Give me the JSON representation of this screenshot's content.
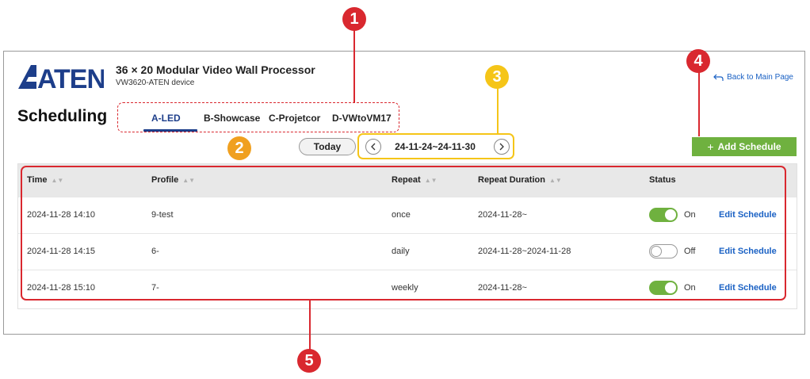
{
  "header": {
    "logo_text": "ATEN",
    "product_title": "36 × 20 Modular Video Wall Processor",
    "device_name": "VW3620-ATEN device",
    "back_link": "Back to Main Page"
  },
  "page_title": "Scheduling",
  "tabs": [
    {
      "label": "A-LED",
      "active": true
    },
    {
      "label": "B-Showcase",
      "active": false
    },
    {
      "label": "C-Projetcor",
      "active": false
    },
    {
      "label": "D-VWtoVM17",
      "active": false
    }
  ],
  "controls": {
    "today_label": "Today",
    "date_range": "24-11-24~24-11-30",
    "add_schedule_label": "Add Schedule"
  },
  "table": {
    "columns": [
      "Time",
      "Profile",
      "Repeat",
      "Repeat Duration",
      "Status"
    ],
    "rows": [
      {
        "time": "2024-11-28 14:10",
        "profile": "9-test",
        "repeat": "once",
        "duration": "2024-11-28~",
        "status": "On",
        "on": true,
        "action": "Edit Schedule"
      },
      {
        "time": "2024-11-28 14:15",
        "profile": "6-",
        "repeat": "daily",
        "duration": "2024-11-28~2024-11-28",
        "status": "Off",
        "on": false,
        "action": "Edit Schedule"
      },
      {
        "time": "2024-11-28 15:10",
        "profile": "7-",
        "repeat": "weekly",
        "duration": "2024-11-28~",
        "status": "On",
        "on": true,
        "action": "Edit Schedule"
      }
    ]
  },
  "annotations": [
    {
      "number": "1",
      "color": "#d9282f"
    },
    {
      "number": "2",
      "color": "#f0a020"
    },
    {
      "number": "3",
      "color": "#f5c518"
    },
    {
      "number": "4",
      "color": "#d9282f"
    },
    {
      "number": "5",
      "color": "#d9282f"
    }
  ],
  "colors": {
    "accent_green": "#6fb13f",
    "link_blue": "#1a61c4",
    "tab_active": "#1d3e8a",
    "callout_red": "#d9282f",
    "callout_yellow": "#f5c518",
    "callout_orange": "#f0a020"
  }
}
